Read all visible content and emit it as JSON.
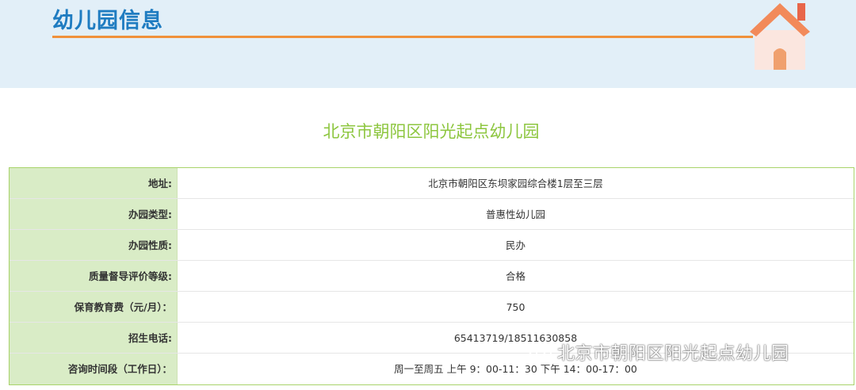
{
  "header": {
    "title": "幼儿园信息"
  },
  "kindergarten": {
    "name": "北京市朝阳区阳光起点幼儿园"
  },
  "info_rows": [
    {
      "label": "地址:",
      "value": "北京市朝阳区东坝家园综合楼1层至三层"
    },
    {
      "label": "办园类型:",
      "value": "普惠性幼儿园"
    },
    {
      "label": "办园性质:",
      "value": "民办"
    },
    {
      "label": "质量督导评价等级:",
      "value": "合格"
    },
    {
      "label": "保育教育费（元/月）：",
      "value": "750"
    },
    {
      "label": "招生电话:",
      "value": "65413719/18511630858"
    },
    {
      "label": "咨询时间段（工作日）：",
      "value": "周一至周五 上午 9：00-11：30 下午 14：00-17：00"
    }
  ],
  "watermark": {
    "text": "北京市朝阳区阳光起点幼儿园",
    "icon": "wechat-icon"
  },
  "colors": {
    "header_bg": "#e2eff8",
    "title_blue": "#1f7cc1",
    "accent_orange": "#f0913b",
    "green": "#8dc63f",
    "label_bg": "#d9ecc6"
  }
}
